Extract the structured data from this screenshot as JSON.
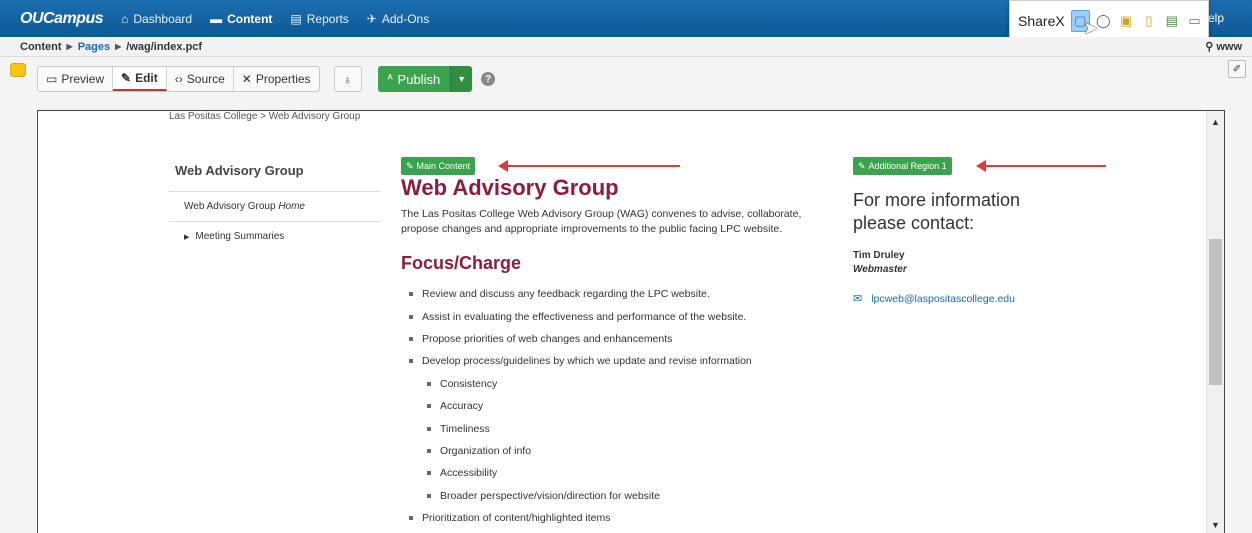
{
  "nav": {
    "brand": "OUCampus",
    "items": [
      {
        "label": "Dashboard",
        "icon": "home-icon"
      },
      {
        "label": "Content",
        "icon": "folder-icon",
        "active": true
      },
      {
        "label": "Reports",
        "icon": "report-icon"
      },
      {
        "label": "Add-Ons",
        "icon": "pin-icon"
      }
    ],
    "help": "Help"
  },
  "sharex": {
    "label": "ShareX"
  },
  "breadcrumb": {
    "root": "Content",
    "pages": "Pages",
    "path": "/wag/index.pcf",
    "site": "www"
  },
  "toolbar": {
    "tabs": [
      {
        "label": "Preview",
        "icon": "monitor-icon"
      },
      {
        "label": "Edit",
        "icon": "pencil-icon",
        "active": true
      },
      {
        "label": "Source",
        "icon": "code-icon"
      },
      {
        "label": "Properties",
        "icon": "tools-icon"
      }
    ],
    "publish": "Publish"
  },
  "page": {
    "crumb": "Las Positas College > Web Advisory Group",
    "sidebar": {
      "title": "Web Advisory Group",
      "items": [
        {
          "text": "Web Advisory Group ",
          "emphasis": "Home"
        },
        {
          "text": "Meeting Summaries"
        }
      ]
    },
    "main_tag": "Main Content",
    "title": "Web Advisory Group",
    "intro": "The Las Positas College Web Advisory Group (WAG) convenes to advise, collaborate, propose changes and appropriate improvements to the public facing LPC website.",
    "focus_title": "Focus/Charge",
    "bullets": [
      {
        "text": "Review and discuss any feedback regarding the LPC website.",
        "level": 1
      },
      {
        "text": "Assist in evaluating the effectiveness and performance of the website.",
        "level": 1
      },
      {
        "text": "Propose priorities of web changes and enhancements",
        "level": 1
      },
      {
        "text": "Develop process/guidelines by which we update and revise information",
        "level": 1
      },
      {
        "text": "Consistency",
        "level": 2
      },
      {
        "text": "Accuracy",
        "level": 2
      },
      {
        "text": "Timeliness",
        "level": 2
      },
      {
        "text": "Organization of info",
        "level": 2
      },
      {
        "text": "Accessibility",
        "level": 2
      },
      {
        "text": "Broader perspective/vision/direction for website",
        "level": 2
      },
      {
        "text": "Prioritization of content/highlighted items",
        "level": 1
      }
    ],
    "additional_tag": "Additional Region 1",
    "contact_title": "For more information please contact:",
    "contact_name": "Tim Druley",
    "contact_role": "Webmaster",
    "contact_email": "lpcweb@laspositascollege.edu"
  }
}
